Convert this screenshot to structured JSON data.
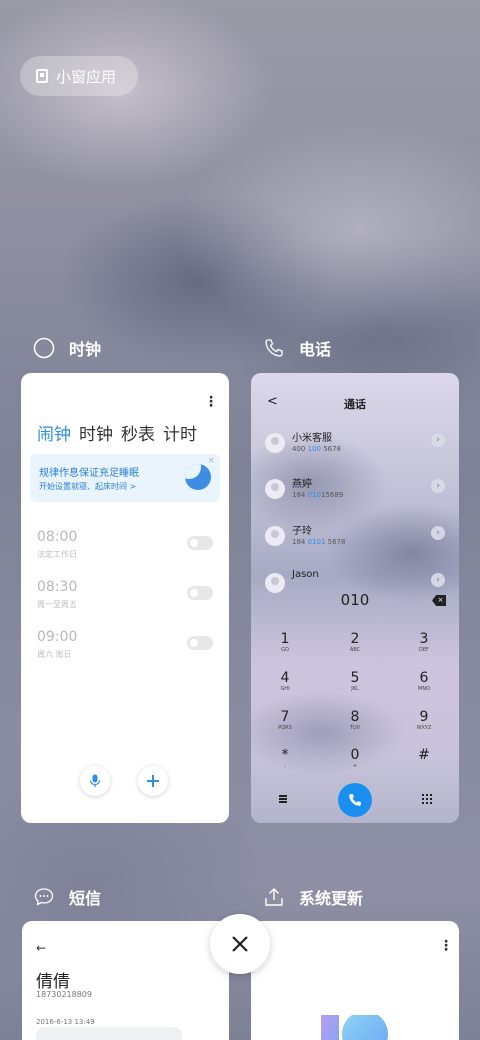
{
  "floating_pill": {
    "label": "小窗应用",
    "icon": "small-window-icon"
  },
  "apps": {
    "clock": {
      "title": "时钟",
      "icon": "clock-icon",
      "tabs": [
        "闹钟",
        "时钟",
        "秒表",
        "计时"
      ],
      "active_tab": "闹钟",
      "banner": {
        "title": "规律作息保证充足睡眠",
        "subtitle": "开始设置就寝、起床时间 >",
        "close": "×"
      },
      "alarms": [
        {
          "time": "08:00",
          "note": "法定工作日",
          "enabled": false
        },
        {
          "time": "08:30",
          "note": "周一至周五",
          "enabled": false
        },
        {
          "time": "09:00",
          "note": "周六 周日",
          "enabled": false
        }
      ]
    },
    "phone": {
      "title": "电话",
      "icon": "phone-icon",
      "screen_title": "通话",
      "back": "<",
      "contacts": [
        {
          "name": "小米客服",
          "num_pre": "400 ",
          "num_hl": "100",
          "num_post": " 5678"
        },
        {
          "name": "燕婷",
          "num_pre": "184 ",
          "num_hl": "010",
          "num_post": "15689"
        },
        {
          "name": "子玲",
          "num_pre": "184 ",
          "num_hl": "0101",
          "num_post": " 5678"
        },
        {
          "name": "Jason",
          "num_pre": "",
          "num_hl": "",
          "num_post": ""
        }
      ],
      "dialed": "010",
      "keys": [
        {
          "num": "1",
          "sub": "GO"
        },
        {
          "num": "2",
          "sub": "ABC"
        },
        {
          "num": "3",
          "sub": "DEF"
        },
        {
          "num": "4",
          "sub": "GHI"
        },
        {
          "num": "5",
          "sub": "JKL"
        },
        {
          "num": "6",
          "sub": "MNO"
        },
        {
          "num": "7",
          "sub": "PQRS"
        },
        {
          "num": "8",
          "sub": "TUV"
        },
        {
          "num": "9",
          "sub": "WXYZ"
        },
        {
          "num": "*",
          "sub": ","
        },
        {
          "num": "0",
          "sub": "+"
        },
        {
          "num": "#",
          "sub": ""
        }
      ]
    },
    "sms": {
      "title": "短信",
      "icon": "message-icon",
      "back": "←",
      "contact_name": "倩倩",
      "contact_phone": "18730218809",
      "date": "2016-6-13 13:49"
    },
    "update": {
      "title": "系统更新",
      "icon": "upload-icon"
    }
  },
  "close_button": {
    "icon": "close-icon"
  },
  "colors": {
    "accent": "#2f8ee0",
    "call_button": "#1a8fef"
  }
}
